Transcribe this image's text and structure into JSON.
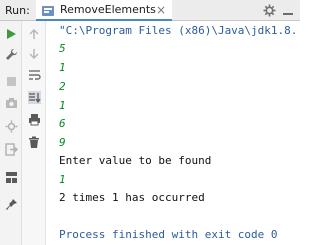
{
  "header": {
    "run_label": "Run:",
    "tab_label": "RemoveElements",
    "tab_close": "×",
    "gear_glyph": "✱",
    "minimize_glyph": "—"
  },
  "console": {
    "command_line": "\"C:\\Program Files (x86)\\Java\\jdk1.8.",
    "inputs": [
      "5",
      "1",
      "2",
      "1",
      "6",
      "9"
    ],
    "prompt": "Enter value to be found",
    "search_value": "1",
    "result": "2 times 1 has occurred",
    "exit_message": "Process finished with exit code 0"
  },
  "colors": {
    "accent": "#4a88c7",
    "input_green": "#0a8a24",
    "system_blue": "#2b5c9e"
  }
}
